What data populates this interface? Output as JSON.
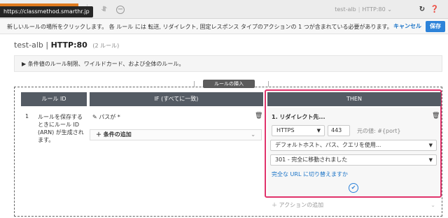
{
  "toolbar": {
    "url_tooltip": "https://classmethod.smarthr.jp",
    "icons": [
      "tab-icon",
      "minus-icon"
    ],
    "lb_name": "test-alb",
    "lb_listener": "HTTP:80",
    "refresh_icon": "refresh-icon",
    "help_icon": "help-icon"
  },
  "instruction": {
    "text": "新しいルールの場所をクリックします。 各 ルール には 転送, リダイレクト, 固定レスポンス タイプのアクションの 1 つが含まれている必要があります。",
    "cancel_label": "キャンセル",
    "save_label": "保存"
  },
  "listener": {
    "lb_name": "test-alb",
    "sep": "|",
    "listener": "HTTP:80",
    "rule_count": "(2 ルール)"
  },
  "note": {
    "text": "▶ 条件値のルール制限、ワイルドカード、および全体のルール。"
  },
  "insert": {
    "label": "ルールの挿入",
    "left_mark": "|",
    "right_mark": "|"
  },
  "columns": {
    "id": "ルール ID",
    "if": "IF (すべてに一致)",
    "then": "THEN"
  },
  "rule": {
    "number": "1",
    "description": "ルールを保存するときにルール ID (ARN) が生成されます。",
    "condition_label": "パスが *",
    "add_condition_label": "条件の追加",
    "action_title": "1. リダイレクト先...",
    "protocol": "HTTPS",
    "port": "443",
    "original_label": "元の値: #{port}",
    "host_path_query": "デフォルトホスト、パス、クエリを使用...",
    "status_code": "301 - 完全に移動されました",
    "switch_link": "完全な URL に切り替えますか",
    "add_action_label": "アクションの追加"
  },
  "colors": {
    "accent": "#2e83d9",
    "highlight": "#e0336b",
    "header": "#545b64"
  }
}
